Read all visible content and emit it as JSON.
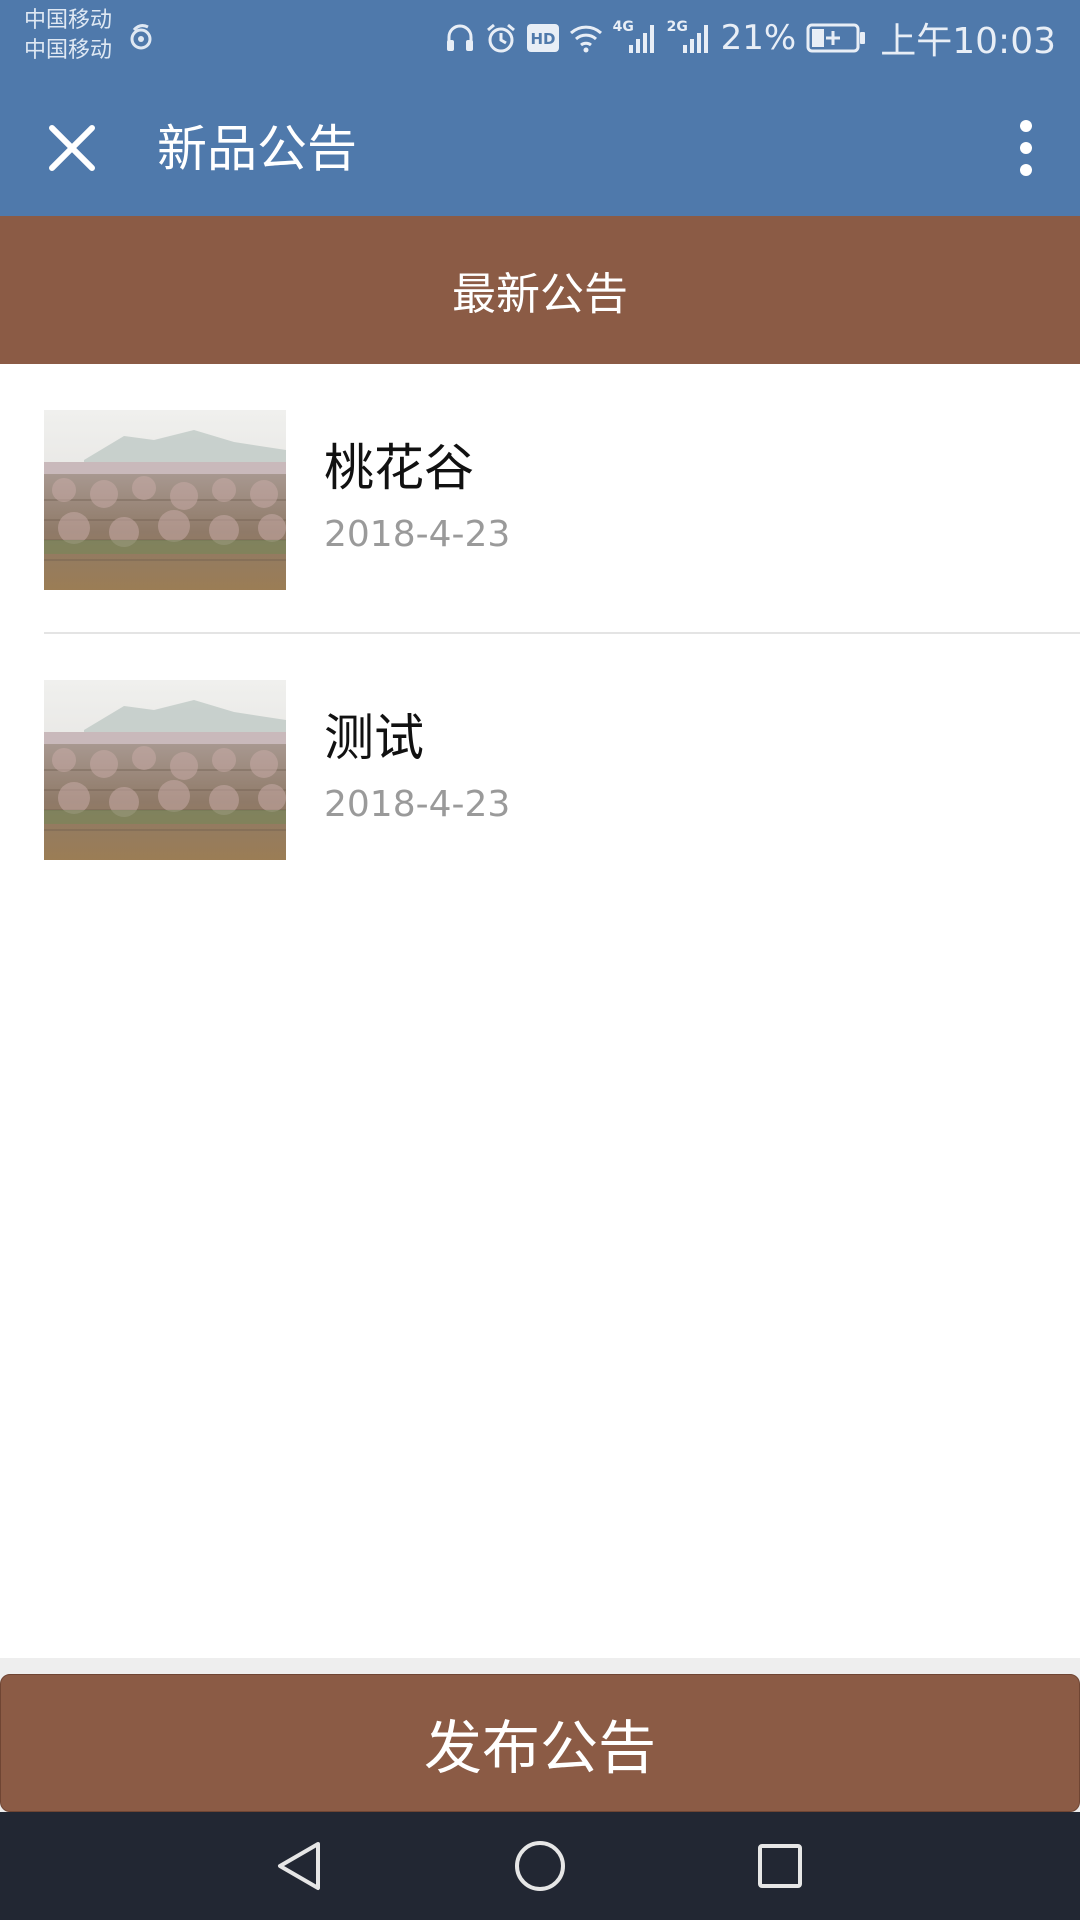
{
  "status_bar": {
    "carrier_1": "中国移动",
    "carrier_2": "中国移动",
    "net_4g": "4G",
    "net_2g": "2G",
    "battery_percent": "21%",
    "time": "上午10:03",
    "icons": [
      "weibo-icon",
      "headphones-icon",
      "alarm-icon",
      "hd-icon",
      "wifi-icon",
      "signal-icon",
      "signal-icon",
      "battery-charging-icon"
    ],
    "hd_label": "HD"
  },
  "title_bar": {
    "title": "新品公告",
    "close_icon": "close-icon",
    "more_icon": "more-vertical-icon"
  },
  "section": {
    "header": "最新公告"
  },
  "notices": [
    {
      "title": "桃花谷",
      "date": "2018-4-23"
    },
    {
      "title": "测试",
      "date": "2018-4-23"
    }
  ],
  "footer": {
    "publish_label": "发布公告"
  },
  "nav_bar": {
    "icons": [
      "back-icon",
      "home-icon",
      "recents-icon"
    ]
  },
  "colors": {
    "header_blue": "#4f79ab",
    "brown": "#8b5b45",
    "nav_dark": "#222733",
    "date_gray": "#9a9a9a"
  }
}
